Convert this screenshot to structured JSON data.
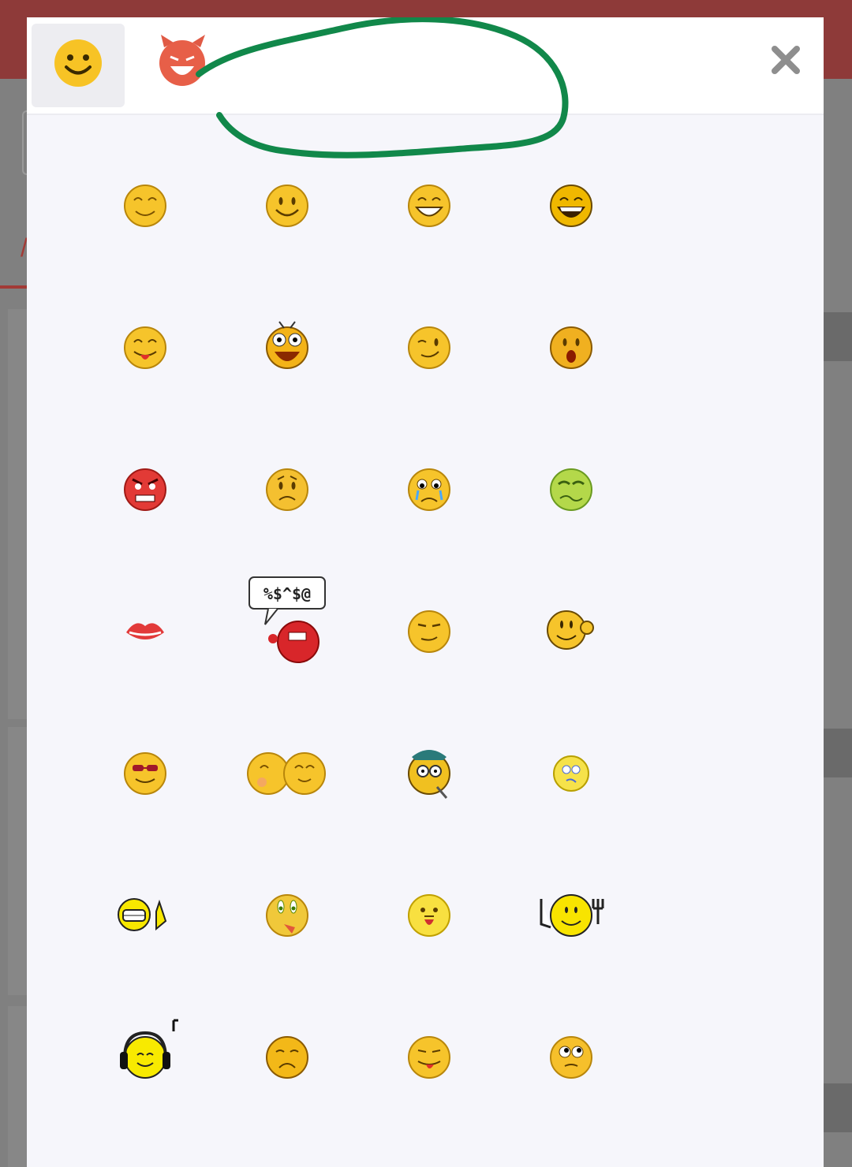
{
  "panel": {
    "tabs": [
      {
        "icon": "smiley-face-icon",
        "active": true
      },
      {
        "icon": "devil-face-icon",
        "active": false
      }
    ],
    "close_icon": "close-icon",
    "annotation_color": "#11884a"
  },
  "emoticons": [
    {
      "icon": "smile-emoticon-icon"
    },
    {
      "icon": "happy-emoticon-icon"
    },
    {
      "icon": "grin-emoticon-icon"
    },
    {
      "icon": "big-grin-emoticon-icon"
    },
    {
      "icon": "tongue-out-emoticon-icon"
    },
    {
      "icon": "surprised-emoticon-icon"
    },
    {
      "icon": "wink-emoticon-icon"
    },
    {
      "icon": "shocked-emoticon-icon"
    },
    {
      "icon": "angry-emoticon-icon"
    },
    {
      "icon": "worried-emoticon-icon"
    },
    {
      "icon": "crying-emoticon-icon"
    },
    {
      "icon": "sick-emoticon-icon"
    },
    {
      "icon": "kiss-lips-emoticon-icon"
    },
    {
      "icon": "cursing-emoticon-icon",
      "bubble_text": "%$^$@"
    },
    {
      "icon": "smug-emoticon-icon"
    },
    {
      "icon": "thinking-emoticon-icon"
    },
    {
      "icon": "cool-sunglasses-emoticon-icon"
    },
    {
      "icon": "hug-emoticon-icon"
    },
    {
      "icon": "nerd-magnifier-emoticon-icon"
    },
    {
      "icon": "confused-emoticon-icon"
    },
    {
      "icon": "laugh-thumbs-emoticon-icon"
    },
    {
      "icon": "drooling-emoticon-icon"
    },
    {
      "icon": "silly-emoticon-icon"
    },
    {
      "icon": "hungry-knife-fork-emoticon-icon"
    },
    {
      "icon": "music-headphones-emoticon-icon"
    },
    {
      "icon": "sad-emoticon-icon"
    },
    {
      "icon": "tongue-emoticon-icon"
    },
    {
      "icon": "eye-roll-emoticon-icon"
    }
  ]
}
